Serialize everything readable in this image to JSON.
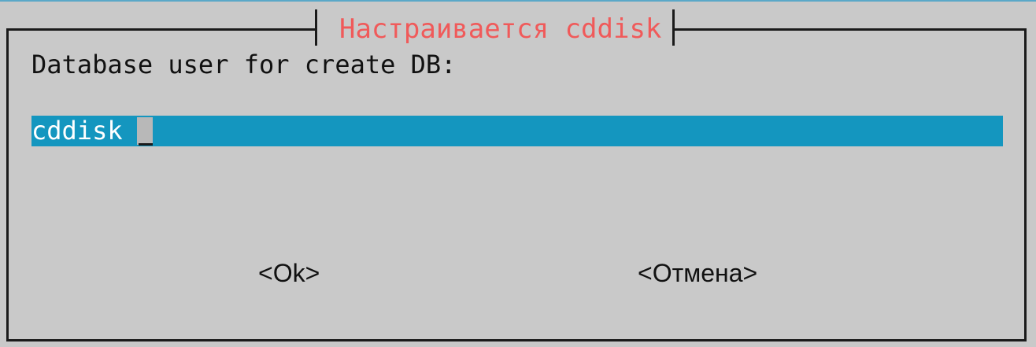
{
  "dialog": {
    "title": "Настраивается cddisk",
    "prompt": "Database user for create DB:",
    "input_value": "cddisk",
    "ok_label": "<Ok>",
    "cancel_label": "<Отмена>"
  },
  "colors": {
    "background": "#c9c9c9",
    "title_text": "#f05a5a",
    "input_background": "#1496bf",
    "input_text": "#ffffff",
    "frame": "#1a1a1a"
  }
}
